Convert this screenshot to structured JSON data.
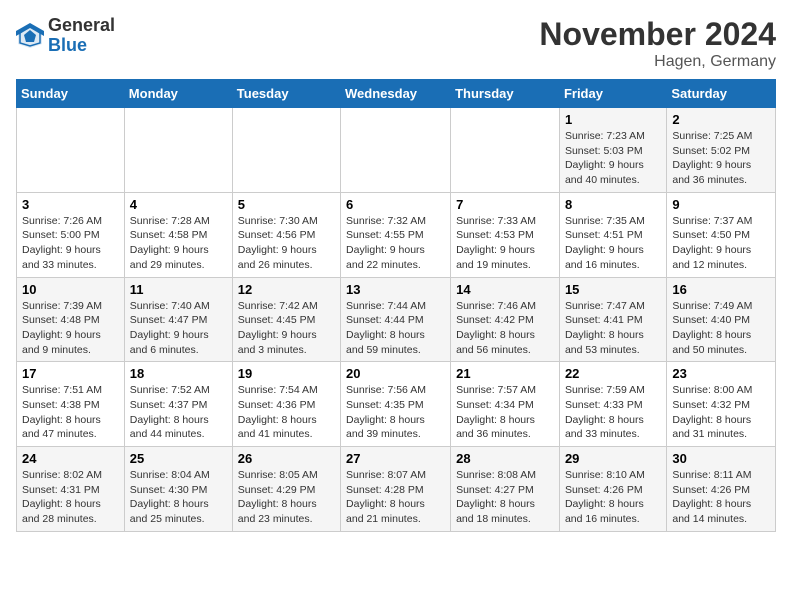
{
  "header": {
    "logo_general": "General",
    "logo_blue": "Blue",
    "month_title": "November 2024",
    "location": "Hagen, Germany"
  },
  "days_of_week": [
    "Sunday",
    "Monday",
    "Tuesday",
    "Wednesday",
    "Thursday",
    "Friday",
    "Saturday"
  ],
  "weeks": [
    [
      {
        "day": "",
        "info": ""
      },
      {
        "day": "",
        "info": ""
      },
      {
        "day": "",
        "info": ""
      },
      {
        "day": "",
        "info": ""
      },
      {
        "day": "",
        "info": ""
      },
      {
        "day": "1",
        "info": "Sunrise: 7:23 AM\nSunset: 5:03 PM\nDaylight: 9 hours and 40 minutes."
      },
      {
        "day": "2",
        "info": "Sunrise: 7:25 AM\nSunset: 5:02 PM\nDaylight: 9 hours and 36 minutes."
      }
    ],
    [
      {
        "day": "3",
        "info": "Sunrise: 7:26 AM\nSunset: 5:00 PM\nDaylight: 9 hours and 33 minutes."
      },
      {
        "day": "4",
        "info": "Sunrise: 7:28 AM\nSunset: 4:58 PM\nDaylight: 9 hours and 29 minutes."
      },
      {
        "day": "5",
        "info": "Sunrise: 7:30 AM\nSunset: 4:56 PM\nDaylight: 9 hours and 26 minutes."
      },
      {
        "day": "6",
        "info": "Sunrise: 7:32 AM\nSunset: 4:55 PM\nDaylight: 9 hours and 22 minutes."
      },
      {
        "day": "7",
        "info": "Sunrise: 7:33 AM\nSunset: 4:53 PM\nDaylight: 9 hours and 19 minutes."
      },
      {
        "day": "8",
        "info": "Sunrise: 7:35 AM\nSunset: 4:51 PM\nDaylight: 9 hours and 16 minutes."
      },
      {
        "day": "9",
        "info": "Sunrise: 7:37 AM\nSunset: 4:50 PM\nDaylight: 9 hours and 12 minutes."
      }
    ],
    [
      {
        "day": "10",
        "info": "Sunrise: 7:39 AM\nSunset: 4:48 PM\nDaylight: 9 hours and 9 minutes."
      },
      {
        "day": "11",
        "info": "Sunrise: 7:40 AM\nSunset: 4:47 PM\nDaylight: 9 hours and 6 minutes."
      },
      {
        "day": "12",
        "info": "Sunrise: 7:42 AM\nSunset: 4:45 PM\nDaylight: 9 hours and 3 minutes."
      },
      {
        "day": "13",
        "info": "Sunrise: 7:44 AM\nSunset: 4:44 PM\nDaylight: 8 hours and 59 minutes."
      },
      {
        "day": "14",
        "info": "Sunrise: 7:46 AM\nSunset: 4:42 PM\nDaylight: 8 hours and 56 minutes."
      },
      {
        "day": "15",
        "info": "Sunrise: 7:47 AM\nSunset: 4:41 PM\nDaylight: 8 hours and 53 minutes."
      },
      {
        "day": "16",
        "info": "Sunrise: 7:49 AM\nSunset: 4:40 PM\nDaylight: 8 hours and 50 minutes."
      }
    ],
    [
      {
        "day": "17",
        "info": "Sunrise: 7:51 AM\nSunset: 4:38 PM\nDaylight: 8 hours and 47 minutes."
      },
      {
        "day": "18",
        "info": "Sunrise: 7:52 AM\nSunset: 4:37 PM\nDaylight: 8 hours and 44 minutes."
      },
      {
        "day": "19",
        "info": "Sunrise: 7:54 AM\nSunset: 4:36 PM\nDaylight: 8 hours and 41 minutes."
      },
      {
        "day": "20",
        "info": "Sunrise: 7:56 AM\nSunset: 4:35 PM\nDaylight: 8 hours and 39 minutes."
      },
      {
        "day": "21",
        "info": "Sunrise: 7:57 AM\nSunset: 4:34 PM\nDaylight: 8 hours and 36 minutes."
      },
      {
        "day": "22",
        "info": "Sunrise: 7:59 AM\nSunset: 4:33 PM\nDaylight: 8 hours and 33 minutes."
      },
      {
        "day": "23",
        "info": "Sunrise: 8:00 AM\nSunset: 4:32 PM\nDaylight: 8 hours and 31 minutes."
      }
    ],
    [
      {
        "day": "24",
        "info": "Sunrise: 8:02 AM\nSunset: 4:31 PM\nDaylight: 8 hours and 28 minutes."
      },
      {
        "day": "25",
        "info": "Sunrise: 8:04 AM\nSunset: 4:30 PM\nDaylight: 8 hours and 25 minutes."
      },
      {
        "day": "26",
        "info": "Sunrise: 8:05 AM\nSunset: 4:29 PM\nDaylight: 8 hours and 23 minutes."
      },
      {
        "day": "27",
        "info": "Sunrise: 8:07 AM\nSunset: 4:28 PM\nDaylight: 8 hours and 21 minutes."
      },
      {
        "day": "28",
        "info": "Sunrise: 8:08 AM\nSunset: 4:27 PM\nDaylight: 8 hours and 18 minutes."
      },
      {
        "day": "29",
        "info": "Sunrise: 8:10 AM\nSunset: 4:26 PM\nDaylight: 8 hours and 16 minutes."
      },
      {
        "day": "30",
        "info": "Sunrise: 8:11 AM\nSunset: 4:26 PM\nDaylight: 8 hours and 14 minutes."
      }
    ]
  ]
}
